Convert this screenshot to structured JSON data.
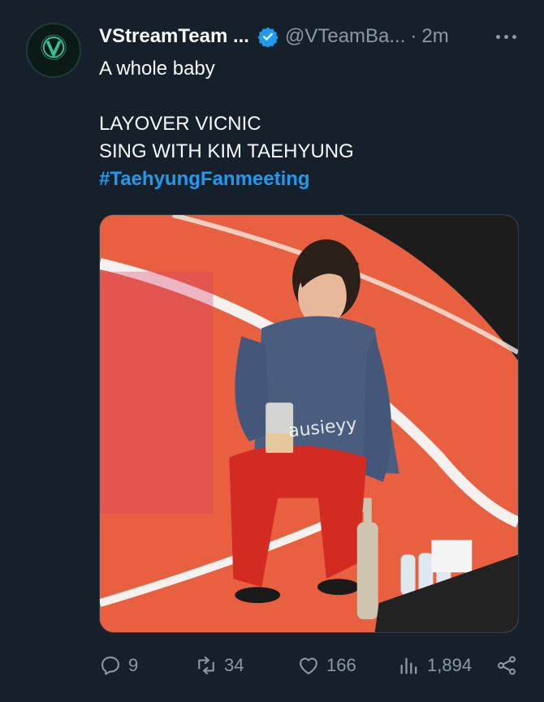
{
  "tweet": {
    "display_name": "VStreamTeam ...",
    "handle": "@VTeamBa...",
    "separator": "·",
    "time": "2m",
    "text_lines": [
      "A whole baby",
      "",
      "LAYOVER VICNIC",
      "SING WITH KIM TAEHYUNG"
    ],
    "hashtag": "#TaehyungFanmeeting",
    "media": {
      "watermark": "ausieyy",
      "colors": {
        "court": "#e8603f",
        "lines": "#f4f1ee",
        "floor": "#1a1a1a"
      }
    }
  },
  "actions": {
    "reply_count": "9",
    "retweet_count": "34",
    "like_count": "166",
    "views_count": "1,894"
  },
  "colors": {
    "background": "#15202b",
    "text": "#f7f9f9",
    "muted": "#8b98a5",
    "accent": "#1d9bf0"
  },
  "icons": {
    "avatar_logo": "v-logo",
    "verified": "verified-badge-icon",
    "more": "more-icon",
    "reply": "reply-icon",
    "retweet": "retweet-icon",
    "like": "heart-icon",
    "views": "views-icon",
    "share": "share-icon"
  }
}
